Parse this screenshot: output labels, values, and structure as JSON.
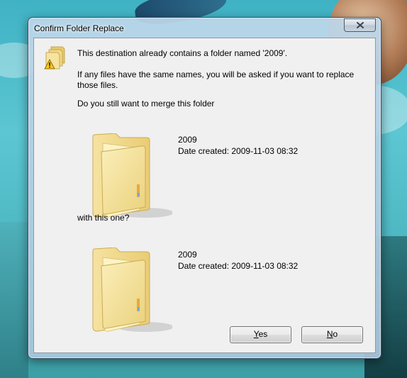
{
  "window": {
    "title": "Confirm Folder Replace",
    "close_symbol": "×"
  },
  "message": {
    "line1": "This destination already contains a folder named '2009'.",
    "line2": "If any files have the same names, you will be asked if you want to replace those files.",
    "line3": "Do you still want to merge this folder",
    "with_text": "with this one?"
  },
  "source_folder": {
    "name": "2009",
    "date_created": "Date created: 2009-11-03 08:32",
    "icon": "folder-icon"
  },
  "destination_folder": {
    "name": "2009",
    "date_created": "Date created: 2009-11-03 08:32",
    "icon": "folder-icon"
  },
  "buttons": {
    "yes": {
      "label_mnemonic": "Y",
      "label_rest": "es"
    },
    "no": {
      "label_mnemonic": "N",
      "label_rest": "o"
    }
  },
  "icons": {
    "header": "folder-warning-icon",
    "close": "close-icon"
  },
  "colors": {
    "dialog_bg": "#f0f0f0",
    "folder": "#f3dc8a",
    "warning": "#f5c518"
  }
}
